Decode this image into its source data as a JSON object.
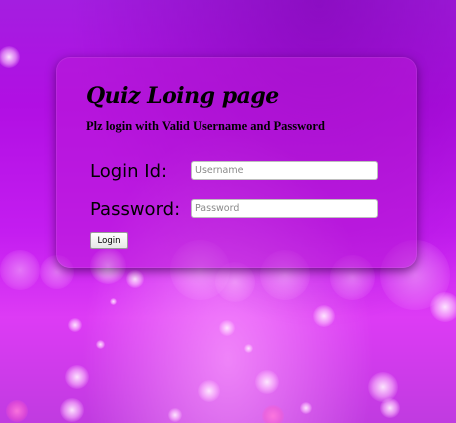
{
  "page": {
    "title": "Quiz Loing page",
    "subtitle": "Plz login with Valid Username and Password"
  },
  "form": {
    "login_label": "Login Id:",
    "username_placeholder": "Username",
    "password_label": "Password:",
    "password_placeholder": "Password",
    "login_button": "Login"
  },
  "colors": {
    "background": "#c41df0",
    "panel": "#b919d7",
    "text": "#000000"
  }
}
